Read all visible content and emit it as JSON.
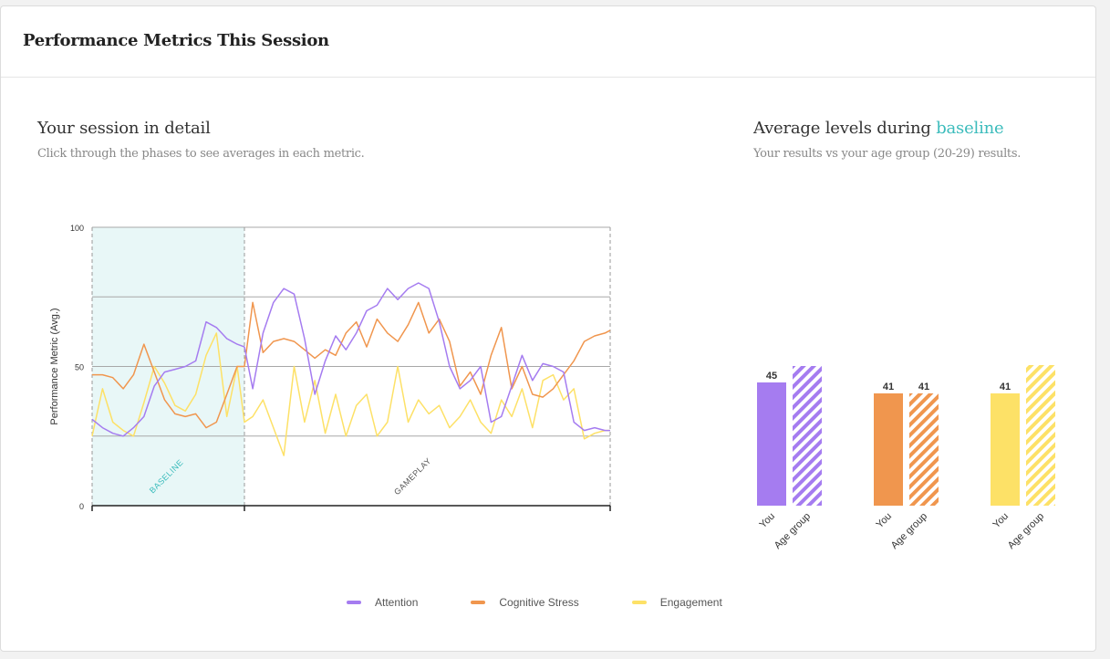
{
  "header": {
    "title": "Performance Metrics This Session"
  },
  "left": {
    "title": "Your session in detail",
    "subtitle": "Click through the phases to see averages in each metric."
  },
  "right": {
    "title_prefix": "Average levels during",
    "title_phase": "baseline",
    "subtitle": "Your results vs your age group (20-29) results."
  },
  "colors": {
    "attention": "#a57cf0",
    "cognitive_stress": "#f0964e",
    "engagement": "#fde167",
    "baseline_band": "#e8f7f7",
    "accent": "#3cbcbc"
  },
  "chart_data": [
    {
      "type": "line",
      "ylabel": "Performance Metric (Avg.)",
      "xlabel": "",
      "ylim": [
        0,
        100
      ],
      "yticks": [
        0,
        50,
        100
      ],
      "grid_lines": [
        25,
        50,
        75,
        100
      ],
      "xlim": [
        0,
        100
      ],
      "phases": [
        {
          "name": "BASELINE",
          "start": 0,
          "end": 29.4
        },
        {
          "name": "GAMEPLAY",
          "start": 29.4,
          "end": 100
        }
      ],
      "legend_position": "bottom",
      "x": [
        0,
        2,
        4,
        6,
        8,
        10,
        12,
        14,
        16,
        18,
        20,
        22,
        24,
        26,
        28,
        29.4,
        31,
        33,
        35,
        37,
        39,
        41,
        43,
        45,
        47,
        49,
        51,
        53,
        55,
        57,
        59,
        61,
        63,
        65,
        67,
        69,
        71,
        73,
        75,
        77,
        79,
        81,
        83,
        85,
        87,
        89,
        91,
        93,
        95,
        97,
        99,
        100
      ],
      "series": [
        {
          "name": "Attention",
          "values": [
            31,
            28,
            26,
            25,
            28,
            32,
            43,
            48,
            49,
            50,
            52,
            66,
            64,
            60,
            58,
            57,
            42,
            62,
            73,
            78,
            76,
            60,
            40,
            52,
            61,
            56,
            62,
            70,
            72,
            78,
            74,
            78,
            80,
            78,
            66,
            50,
            42,
            45,
            50,
            30,
            32,
            43,
            54,
            45,
            51,
            50,
            48,
            30,
            27,
            28,
            27,
            27
          ]
        },
        {
          "name": "Cognitive Stress",
          "values": [
            47,
            47,
            46,
            42,
            47,
            58,
            48,
            38,
            33,
            32,
            33,
            28,
            30,
            40,
            50,
            50,
            73,
            55,
            59,
            60,
            59,
            56,
            53,
            56,
            54,
            62,
            66,
            57,
            67,
            62,
            59,
            65,
            73,
            62,
            67,
            59,
            43,
            48,
            40,
            54,
            64,
            42,
            50,
            40,
            39,
            42,
            47,
            52,
            59,
            61,
            62,
            63
          ]
        },
        {
          "name": "Engagement",
          "values": [
            25,
            42,
            30,
            27,
            25,
            37,
            50,
            44,
            36,
            34,
            40,
            54,
            62,
            32,
            50,
            30,
            32,
            38,
            28,
            18,
            50,
            30,
            45,
            26,
            40,
            25,
            36,
            40,
            25,
            30,
            50,
            30,
            38,
            33,
            36,
            28,
            32,
            38,
            30,
            26,
            38,
            32,
            42,
            28,
            45,
            47,
            38,
            42,
            24,
            26,
            27,
            27
          ]
        }
      ]
    },
    {
      "type": "bar",
      "groups": [
        "Attention",
        "Cognitive Stress",
        "Engagement"
      ],
      "categories": [
        "You",
        "Age group"
      ],
      "ylim": [
        0,
        100
      ],
      "series": [
        {
          "name": "Attention",
          "values": [
            45,
            51
          ]
        },
        {
          "name": "Cognitive Stress",
          "values": [
            41,
            41
          ]
        },
        {
          "name": "Engagement",
          "values": [
            41,
            54
          ]
        }
      ]
    }
  ]
}
